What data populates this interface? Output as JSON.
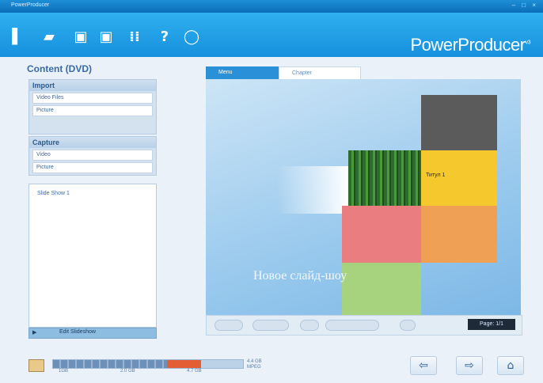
{
  "window": {
    "title": "PowerProducer",
    "controls": "– □ ×"
  },
  "toolbar": {
    "icons": [
      "new-file-icon",
      "open-folder-icon",
      "save-icon",
      "save-as-icon",
      "settings-icon",
      "help-icon",
      "info-icon"
    ],
    "brand": "PowerProducer",
    "brand_version": "v3"
  },
  "left_panel": {
    "title": "Content (DVD)",
    "import_group": {
      "header": "Import",
      "rows": [
        "Video Files",
        "Picture"
      ]
    },
    "capture_group": {
      "header": "Capture",
      "rows": [
        "Video",
        "Picture"
      ]
    },
    "list_items": [
      "Slide Show 1"
    ],
    "bottom_label": "Edit Slideshow"
  },
  "preview": {
    "tabs": [
      "Menu",
      "Chapter"
    ],
    "caption": "Новое слайд-шоу",
    "yellow_label": "Титул 1",
    "controls": [
      "",
      "",
      "",
      "",
      ""
    ],
    "page_label": "Page: 1/1"
  },
  "status": {
    "ticks": [
      "1GB",
      "2.0 GB",
      "4.7 GB"
    ],
    "size_lines": [
      "4.4 GB",
      "MPEG"
    ],
    "meter_fill": 0.78,
    "meter_over": 0.18
  },
  "nav": {
    "back": "⇦",
    "next": "⇨",
    "home": "⌂"
  }
}
